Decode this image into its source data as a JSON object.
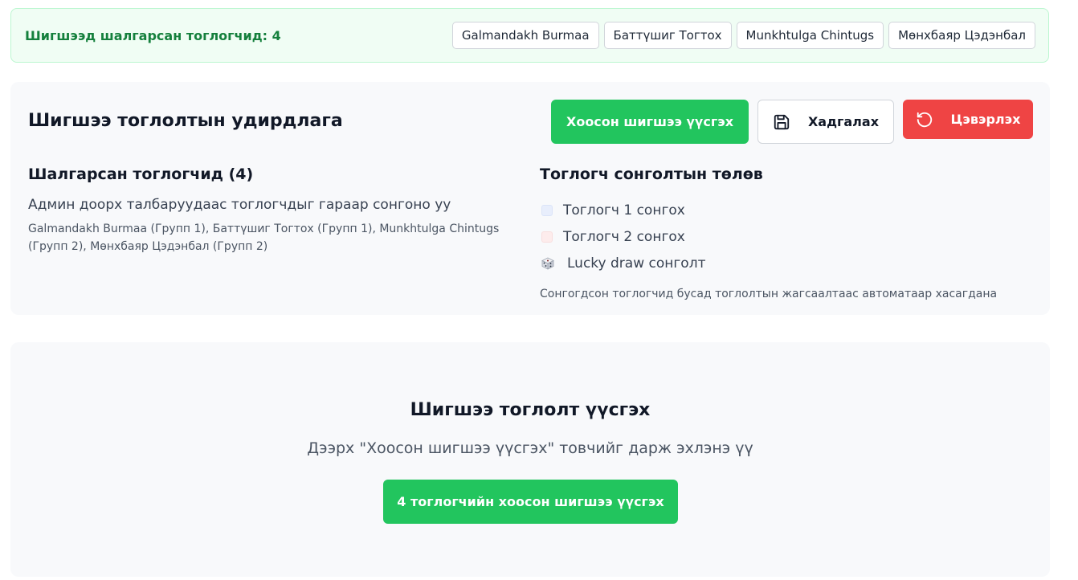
{
  "banner": {
    "title": "Шигшээд шалгарсан тоглогчид: 4",
    "chips": [
      "Galmandakh Burmaa",
      "Баттүшиг Тогтох",
      "Munkhtulga Chintugs",
      "Мөнхбаяр Цэдэнбал"
    ]
  },
  "panel": {
    "title": "Шигшээ тоглолтын удирдлага",
    "actions": {
      "create_empty_label": "Хоосон шигшээ үүсгэх",
      "save_label": "Хадгалах",
      "reset_label": "Цэвэрлэх"
    },
    "selected": {
      "title": "Шалгарсан тоглогчид (4)",
      "hint": "Админ доорх талбаруудаас тоглогчдыг гараар сонгоно уу",
      "list": "Galmandakh Burmaa (Групп 1), Баттүшиг Тогтох (Групп 1), Munkhtulga Chintugs (Групп 2), Мөнхбаяр Цэдэнбал (Групп 2)"
    },
    "status": {
      "title": "Тоглогч сонголтын төлөв",
      "option1": "Тоглогч 1 сонгох",
      "option2": "Тоглогч 2 сонгох",
      "option3": "Lucky draw сонголт",
      "note": "Сонгогдсон тоглогчид бусад тоглолтын жагсаалтаас автоматаар хасагдана"
    }
  },
  "create": {
    "title": "Шигшээ тоглолт үүсгэх",
    "subtitle": "Дээрх \"Хоосон шигшээ үүсгэх\" товчийг дарж эхлэнэ үү",
    "button_label": "4 тоглогчийн хоосон шигшээ үүсгэх"
  },
  "colors": {
    "primary_green": "#22c55e",
    "danger_red": "#ef4444",
    "banner_green": "#15803d"
  },
  "icons": {
    "save": "floppy-disk-icon",
    "reset": "rotate-ccw-icon",
    "dice": "dice-icon"
  }
}
